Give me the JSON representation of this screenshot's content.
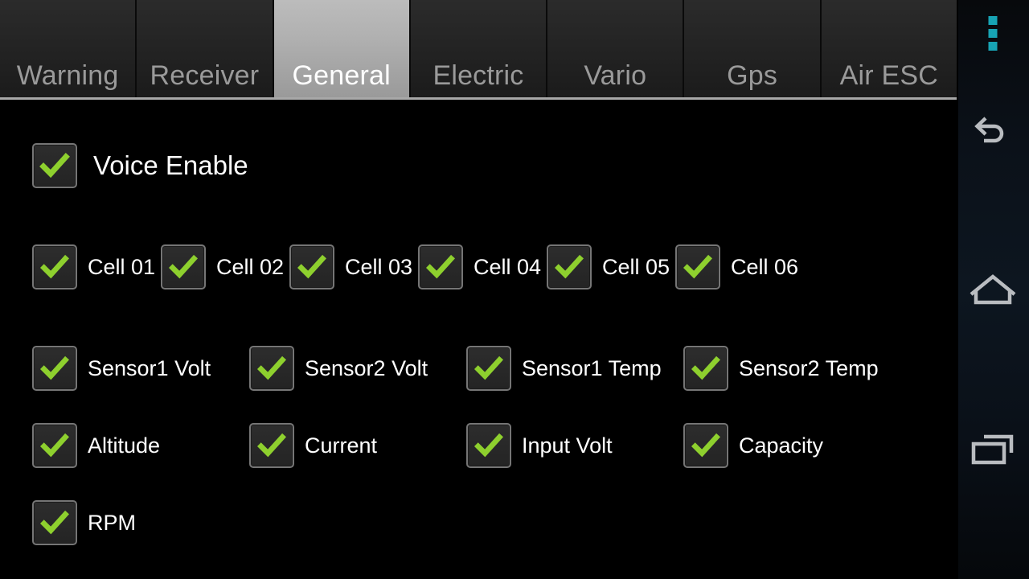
{
  "app": {
    "title": "General"
  },
  "tabs": [
    {
      "label": "Warning",
      "selected": false
    },
    {
      "label": "Receiver",
      "selected": false
    },
    {
      "label": "General",
      "selected": true
    },
    {
      "label": "Electric",
      "selected": false
    },
    {
      "label": "Vario",
      "selected": false
    },
    {
      "label": "Gps",
      "selected": false
    },
    {
      "label": "Air ESC",
      "selected": false
    }
  ],
  "settings": {
    "voice": {
      "label": "Voice Enable",
      "checked": true
    },
    "cells": [
      {
        "label": "Cell 01",
        "checked": true
      },
      {
        "label": "Cell 02",
        "checked": true
      },
      {
        "label": "Cell 03",
        "checked": true
      },
      {
        "label": "Cell 04",
        "checked": true
      },
      {
        "label": "Cell 05",
        "checked": true
      },
      {
        "label": "Cell 06",
        "checked": true
      }
    ],
    "sensors": [
      {
        "label": "Sensor1 Volt",
        "checked": true
      },
      {
        "label": "Sensor2 Volt",
        "checked": true
      },
      {
        "label": "Sensor1 Temp",
        "checked": true
      },
      {
        "label": "Sensor2 Temp",
        "checked": true
      }
    ],
    "telemetry": [
      {
        "label": "Altitude",
        "checked": true
      },
      {
        "label": "Current",
        "checked": true
      },
      {
        "label": "Input Volt",
        "checked": true
      },
      {
        "label": "Capacity",
        "checked": true
      }
    ],
    "misc": [
      {
        "label": "RPM",
        "checked": true
      }
    ]
  },
  "navbar": {
    "overflow": "overflow-menu",
    "back": "back",
    "home": "home",
    "recents": "recent-apps"
  },
  "colors": {
    "background": "#000000",
    "check_green": "#8ed02e",
    "tab_selected_text": "#ffffff",
    "tab_text": "#9a9a9a",
    "accent_teal": "#17a3b4",
    "nav_icon": "#b9bcc0"
  }
}
